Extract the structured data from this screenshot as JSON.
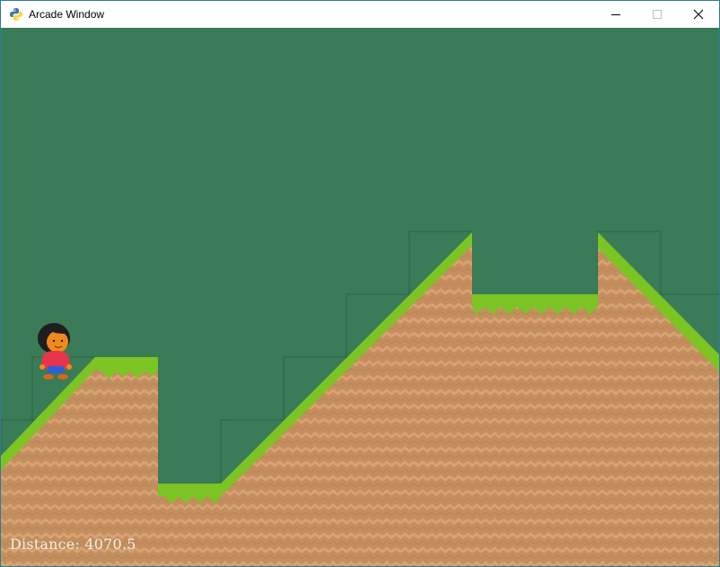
{
  "window": {
    "title": "Arcade Window",
    "controls": {
      "minimize": "minimize",
      "maximize": "maximize",
      "close": "close"
    }
  },
  "game": {
    "background_color": "#3a7b58",
    "ground_color": "#c38f5f",
    "ground_pattern_color": "#d9a272",
    "grass_color": "#7bc423",
    "grass_dark_color": "#63a91a"
  },
  "hud": {
    "distance_label": "Distance: 4070.5"
  },
  "player": {
    "sprite": "player-character",
    "hair_color": "#1e1e1e",
    "skin_color": "#f08a1d",
    "shirt_color": "#e8344a",
    "pants_color": "#2f5fd6"
  }
}
